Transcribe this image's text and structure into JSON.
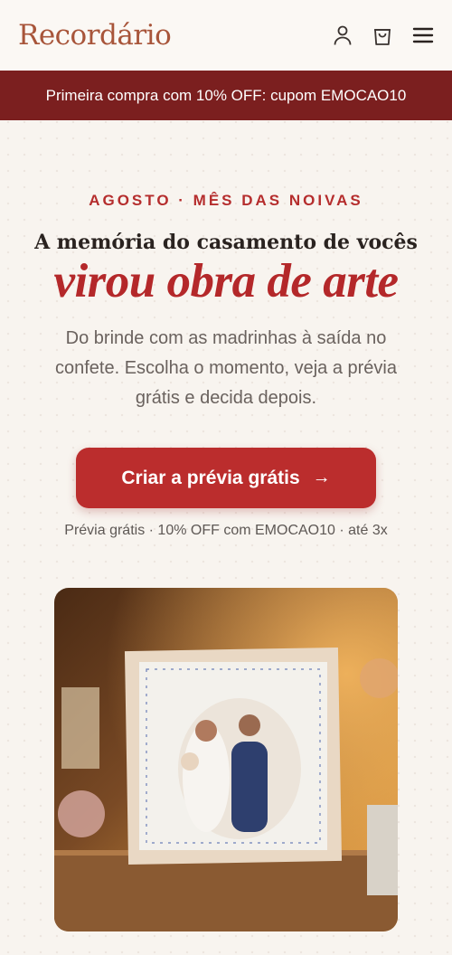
{
  "brand": {
    "name": "Recordário"
  },
  "header": {
    "account_icon": "user-icon",
    "cart_icon": "shopping-bag-icon",
    "menu_icon": "hamburger-menu-icon"
  },
  "promo": {
    "text": "Primeira compra com 10% OFF: cupom EMOCAO10"
  },
  "hero": {
    "eyebrow": "AGOSTO · MÊS DAS NOIVAS",
    "headline": "A memória do casamento de vocês",
    "headline_accent": "virou obra de arte",
    "subtext": "Do brinde com as madrinhas à saída no confete. Escolha o momento, veja a prévia grátis e decida depois.",
    "cta_label": "Criar a prévia grátis",
    "cta_arrow": "→",
    "cta_note": "Prévia grátis · 10% OFF com EMOCAO10 · até 3x"
  },
  "colors": {
    "brand": "#a8553a",
    "promo_bar": "#7b1f1f",
    "accent": "#b4282a",
    "cta": "#bb2d2d"
  }
}
